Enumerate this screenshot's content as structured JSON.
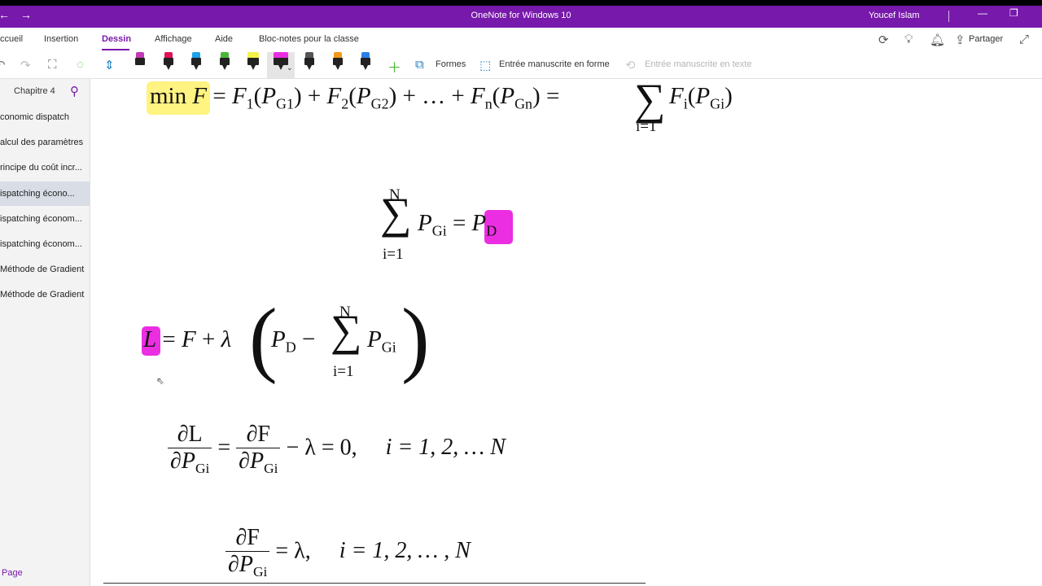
{
  "window": {
    "title": "OneNote for Windows 10",
    "user": "Youcef Islam",
    "accent": "#7719aa"
  },
  "ribbon": {
    "tabs": [
      "ccueil",
      "Insertion",
      "Dessin",
      "Affichage",
      "Aide",
      "Bloc-notes pour la classe"
    ],
    "active_tab": "Dessin",
    "share_label": "Partager"
  },
  "toolbar": {
    "shapes_label": "Formes",
    "ink_to_shape_label": "Entrée manuscrite en forme",
    "ink_to_text_label": "Entrée manuscrite en texte",
    "pen_colors": [
      "#c239b3",
      "#e3105a",
      "#1ea1e8",
      "#49b837",
      "#f5f04a",
      "#ec2ee3",
      "#222222",
      "#f39a1a",
      "#2b7ee6"
    ]
  },
  "nav": {
    "section": "Chapitre 4",
    "pages": [
      "conomic dispatch",
      "alcul des paramètres",
      "rincipe du coût incr...",
      "ispatching écono...",
      "ispatching économ...",
      "ispatching économ...",
      "Méthode de Gradient",
      "Méthode de Gradient"
    ],
    "selected_index": 3,
    "add_page_label": "Page"
  },
  "equations": {
    "eq1_min": "min",
    "eq1_F": "F",
    "eq1_rhs_parts": [
      "F",
      "1",
      "P",
      "G1",
      "F",
      "2",
      "P",
      "G2",
      "…",
      "F",
      "n",
      "P",
      "Gn"
    ],
    "eq1_sum_lower": "i=1",
    "eq1_tail_F": "F",
    "eq1_tail_i": "i",
    "eq1_tail_P": "P",
    "eq1_tail_Gi": "Gi",
    "eq2_upper": "N",
    "eq2_lower": "i=1",
    "eq2_P": "P",
    "eq2_Gi": "Gi",
    "eq2_rhs_P": "P",
    "eq2_rhs_D": "D",
    "eq3_L": "L",
    "eq3_F": "F",
    "eq3_lambda": "λ",
    "eq3_PD_P": "P",
    "eq3_PD_D": "D",
    "eq3_upper": "N",
    "eq3_lower": "i=1",
    "eq3_P": "P",
    "eq3_Gi": "Gi",
    "eq4_num1": "∂L",
    "eq4_den1_a": "∂P",
    "eq4_den1_b": "Gi",
    "eq4_num2": "∂F",
    "eq4_den2_a": "∂P",
    "eq4_den2_b": "Gi",
    "eq4_tail": "− λ = 0,",
    "eq4_index": "i = 1, 2, … N",
    "eq5_num": "∂F",
    "eq5_den_a": "∂P",
    "eq5_den_b": "Gi",
    "eq5_tail": "= λ,",
    "eq5_index": "i = 1, 2, … , N"
  }
}
